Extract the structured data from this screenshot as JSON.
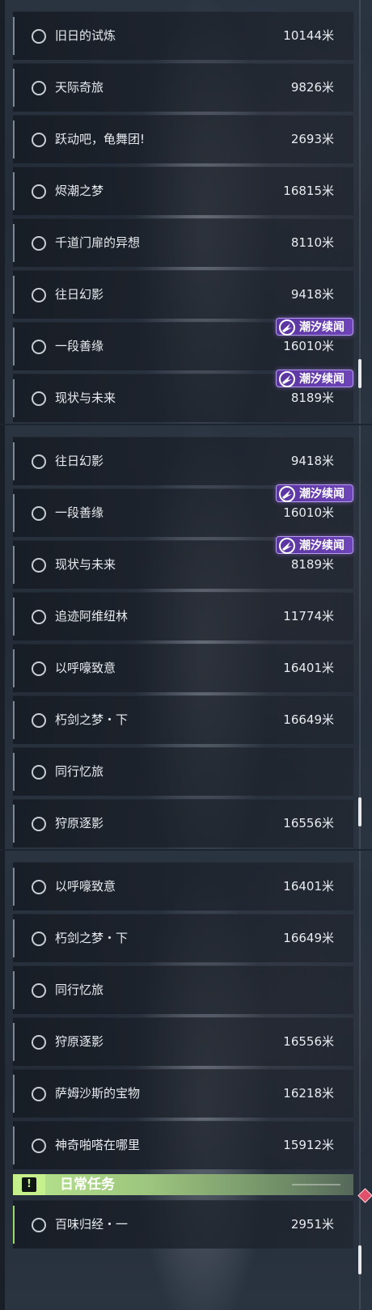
{
  "unit": "米",
  "badge_label": "潮汐续闻",
  "panels": [
    {
      "rows": [
        {
          "name": "旧日的试炼",
          "distance": "10144米"
        },
        {
          "name": "天际奇旅",
          "distance": "9826米"
        },
        {
          "name": "跃动吧，龟舞团!",
          "distance": "2693米"
        },
        {
          "name": "烬潮之梦",
          "distance": "16815米"
        },
        {
          "name": "千道门扉的异想",
          "distance": "8110米"
        },
        {
          "name": "往日幻影",
          "distance": "9418米"
        },
        {
          "name": "一段善缘",
          "distance": "16010米",
          "badge": "潮汐续闻"
        },
        {
          "name": "现状与未来",
          "distance": "8189米",
          "badge": "潮汐续闻"
        }
      ]
    },
    {
      "rows": [
        {
          "name": "往日幻影",
          "distance": "9418米"
        },
        {
          "name": "一段善缘",
          "distance": "16010米",
          "badge": "潮汐续闻"
        },
        {
          "name": "现状与未来",
          "distance": "8189米",
          "badge": "潮汐续闻"
        },
        {
          "name": "追迹阿维纽林",
          "distance": "11774米"
        },
        {
          "name": "以呼嚎致意",
          "distance": "16401米"
        },
        {
          "name": "朽剑之梦・下",
          "distance": "16649米"
        },
        {
          "name": "同行忆旅",
          "distance": ""
        },
        {
          "name": "狩原逐影",
          "distance": "16556米"
        }
      ]
    },
    {
      "rows": [
        {
          "name": "以呼嚎致意",
          "distance": "16401米"
        },
        {
          "name": "朽剑之梦・下",
          "distance": "16649米"
        },
        {
          "name": "同行忆旅",
          "distance": ""
        },
        {
          "name": "狩原逐影",
          "distance": "16556米"
        },
        {
          "name": "萨姆沙斯的宝物",
          "distance": "16218米"
        },
        {
          "name": "神奇啪嗒在哪里",
          "distance": "15912米"
        }
      ],
      "section": {
        "title": "日常任务",
        "icon": "!"
      },
      "daily_rows": [
        {
          "name": "百味归经・一",
          "distance": "2951米"
        }
      ]
    }
  ],
  "icons": {
    "row_status": "circle-outline-icon",
    "badge": "tide-sparkle-icon",
    "section": "exclamation-icon",
    "alert": "diamond-alert-icon"
  },
  "colors": {
    "badge_bg": "#6e44b8",
    "section_header": "#b8e68c",
    "alert": "#e0506a",
    "text": "#e9ecf0"
  }
}
